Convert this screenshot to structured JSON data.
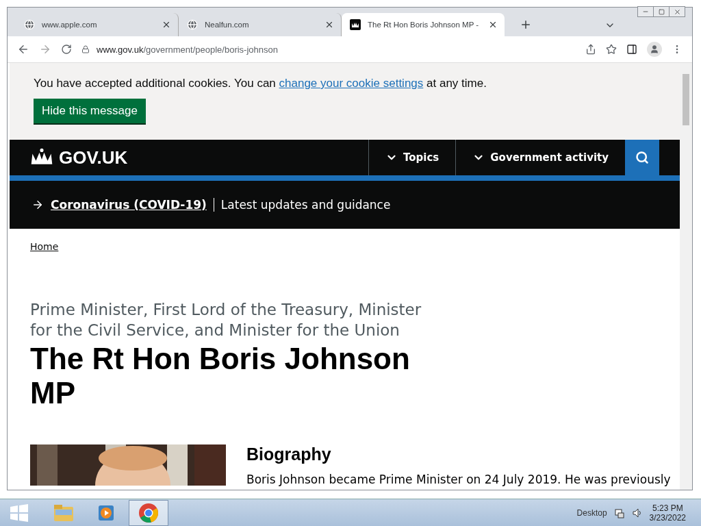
{
  "tabs": [
    {
      "title": "www.apple.com",
      "selected": false
    },
    {
      "title": "Nealfun.com",
      "selected": false
    },
    {
      "title": "The Rt Hon Boris Johnson MP -",
      "selected": true
    }
  ],
  "address_bar": {
    "domain": "www.gov.uk",
    "path": "/government/people/boris-johnson"
  },
  "cookie_banner": {
    "text_before": "You have accepted additional cookies. You can ",
    "link": "change your cookie settings",
    "text_after": " at any time.",
    "button": "Hide this message"
  },
  "header": {
    "logo": "GOV.UK",
    "nav": [
      "Topics",
      "Government activity"
    ]
  },
  "covid_banner": {
    "link": "Coronavirus (COVID-19)",
    "text": "Latest updates and guidance"
  },
  "breadcrumb": "Home",
  "person": {
    "role": "Prime Minister, First Lord of the Treasury, Minister for the Civil Service, and Minister for the Union",
    "name": "The Rt Hon Boris Johnson MP",
    "section_title": "Biography",
    "bio": "Boris Johnson became Prime Minister on 24 July 2019. He was previously"
  },
  "taskbar": {
    "apps": [
      {
        "kind": "folder",
        "selected": false
      },
      {
        "kind": "media",
        "selected": false
      },
      {
        "kind": "chrome",
        "selected": true
      }
    ],
    "desktop": "Desktop",
    "time": "5:23 PM",
    "date": "3/23/2022"
  }
}
